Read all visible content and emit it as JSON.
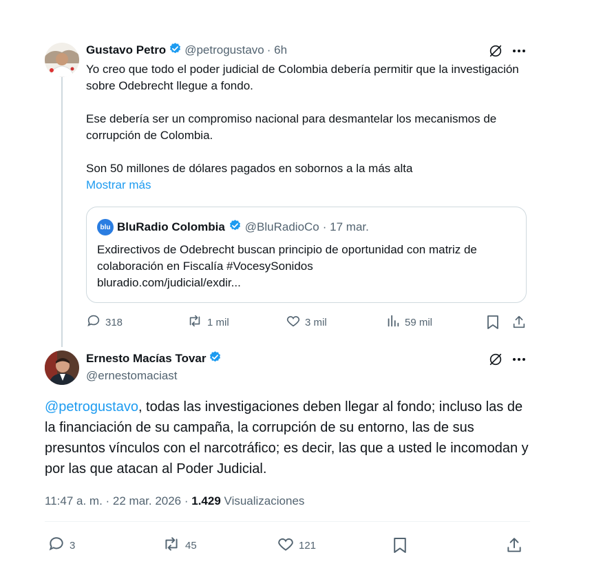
{
  "parent_tweet": {
    "name": "Gustavo Petro",
    "handle": "@petrogustavo",
    "time": "· 6h",
    "paragraphs": [
      "Yo creo que todo el poder judicial de Colombia debería permitir que la investigación sobre Odebrecht llegue a fondo.",
      "Ese debería ser un compromiso nacional para desmantelar los mecanismos de corrupción de Colombia.",
      "Son 50 millones de dólares pagados en sobornos a la más alta"
    ],
    "show_more": "Mostrar más",
    "quote": {
      "name": "BluRadio Colombia",
      "handle": "@BluRadioCo",
      "time": "· 17 mar.",
      "avatar_text": "blu",
      "text": "Exdirectivos de Odebrecht buscan principio de oportunidad con matriz de colaboración en Fiscalía #VocesySonidos",
      "link": "bluradio.com/judicial/exdir..."
    },
    "stats": {
      "replies": "318",
      "retweets": "1 mil",
      "likes": "3 mil",
      "views": "59 mil"
    }
  },
  "reply_tweet": {
    "name": "Ernesto Macías Tovar",
    "handle": "@ernestomaciast",
    "mention": "@petrogustavo",
    "text": ", todas las investigaciones deben llegar al fondo; incluso las de la financiación de su campaña, la corrupción de su entorno, las de sus presuntos vínculos con el narcotráfico; es decir, las que a usted le incomodan y por las que atacan al Poder Judicial.",
    "timestamp": "11:47 a. m. · 22 mar. 2026 ·",
    "views_count": "1.429",
    "views_label": "Visualizaciones",
    "stats": {
      "replies": "3",
      "retweets": "45",
      "likes": "121"
    }
  },
  "colors": {
    "accent": "#1d9bf0",
    "text": "#0f1419",
    "muted": "#536471",
    "border": "#cfd9de"
  },
  "icons": [
    "verified-badge-icon",
    "grok-icon",
    "more-icon",
    "reply-icon",
    "retweet-icon",
    "like-icon",
    "views-icon",
    "bookmark-icon",
    "share-icon"
  ]
}
